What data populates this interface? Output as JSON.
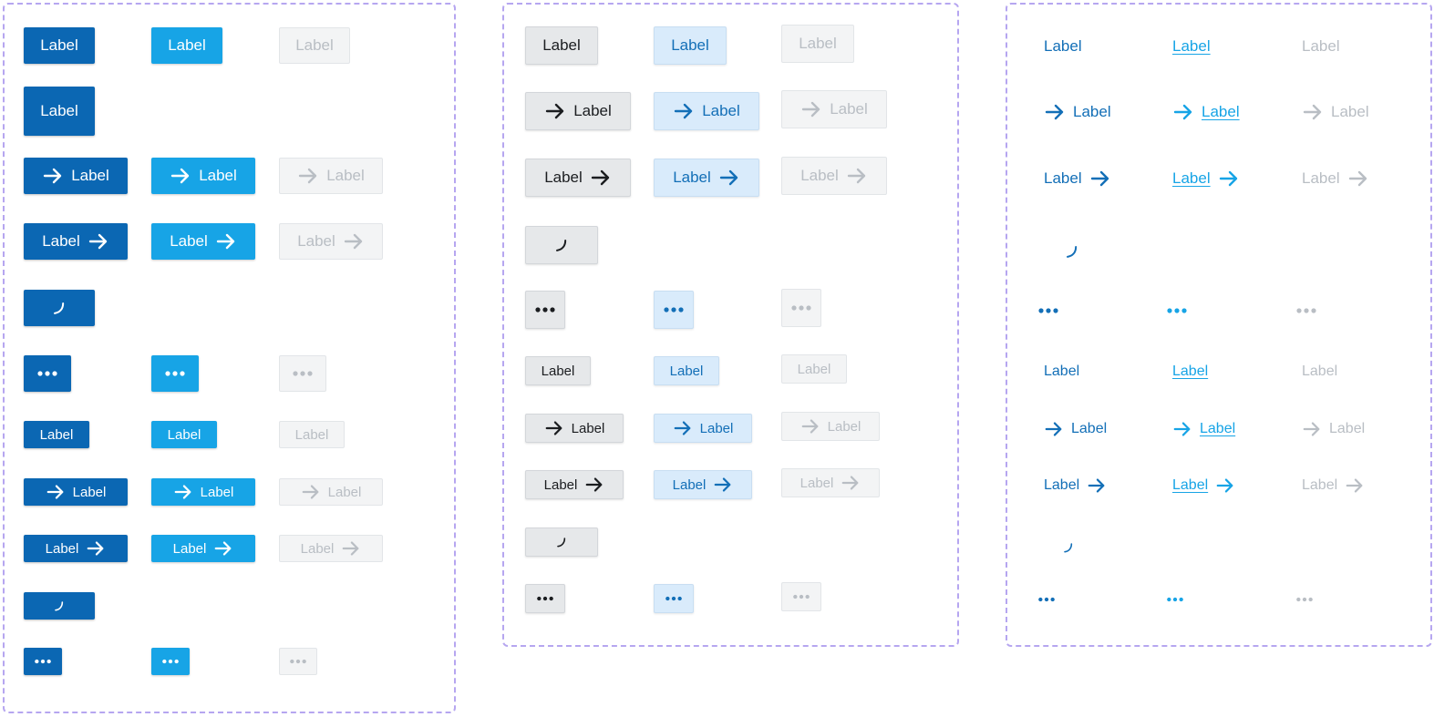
{
  "button_label": "Label",
  "icons": {
    "arrow": "arrow-right-icon",
    "loader": "loading-spinner-icon",
    "more": "more-horizontal-icon"
  },
  "colors": {
    "primary_default": "#0b67b3",
    "primary_hover": "#17a4e6",
    "disabled_bg": "#f3f4f5",
    "disabled_text": "#b9bec4",
    "secondary_default": "#e6e8ea",
    "secondary_hover": "#d9ebfb",
    "link_default": "#136fb7",
    "link_hover": "#17a4e6",
    "panel_border": "#b6a6f0"
  }
}
